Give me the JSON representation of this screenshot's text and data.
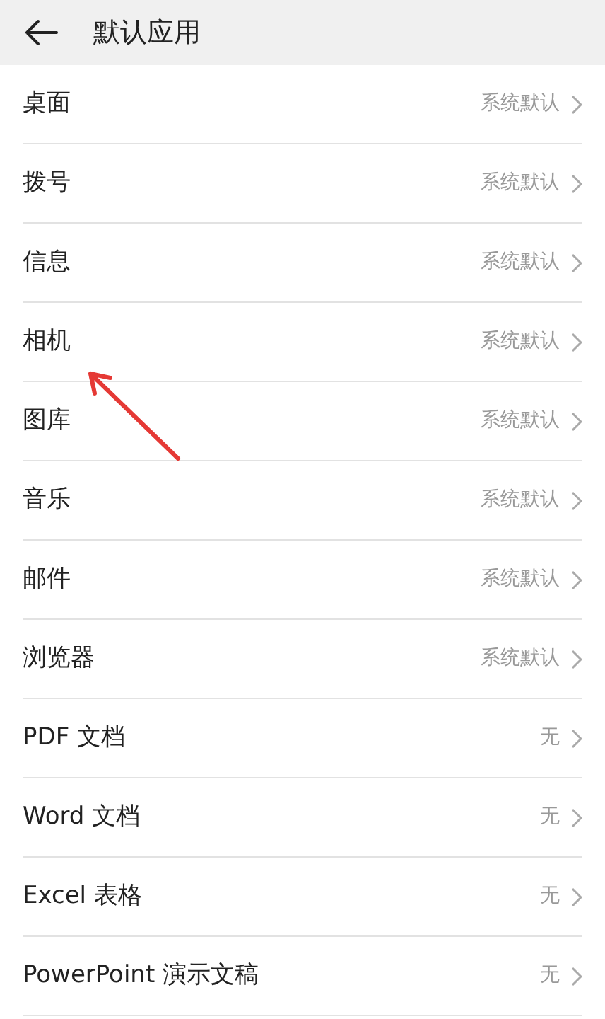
{
  "header": {
    "title": "默认应用"
  },
  "items": [
    {
      "label": "桌面",
      "value": "系统默认"
    },
    {
      "label": "拨号",
      "value": "系统默认"
    },
    {
      "label": "信息",
      "value": "系统默认"
    },
    {
      "label": "相机",
      "value": "系统默认"
    },
    {
      "label": "图库",
      "value": "系统默认"
    },
    {
      "label": "音乐",
      "value": "系统默认"
    },
    {
      "label": "邮件",
      "value": "系统默认"
    },
    {
      "label": "浏览器",
      "value": "系统默认"
    },
    {
      "label": "PDF 文档",
      "value": "无"
    },
    {
      "label": "Word 文档",
      "value": "无"
    },
    {
      "label": "Excel 表格",
      "value": "无"
    },
    {
      "label": "PowerPoint 演示文稿",
      "value": "无"
    }
  ]
}
